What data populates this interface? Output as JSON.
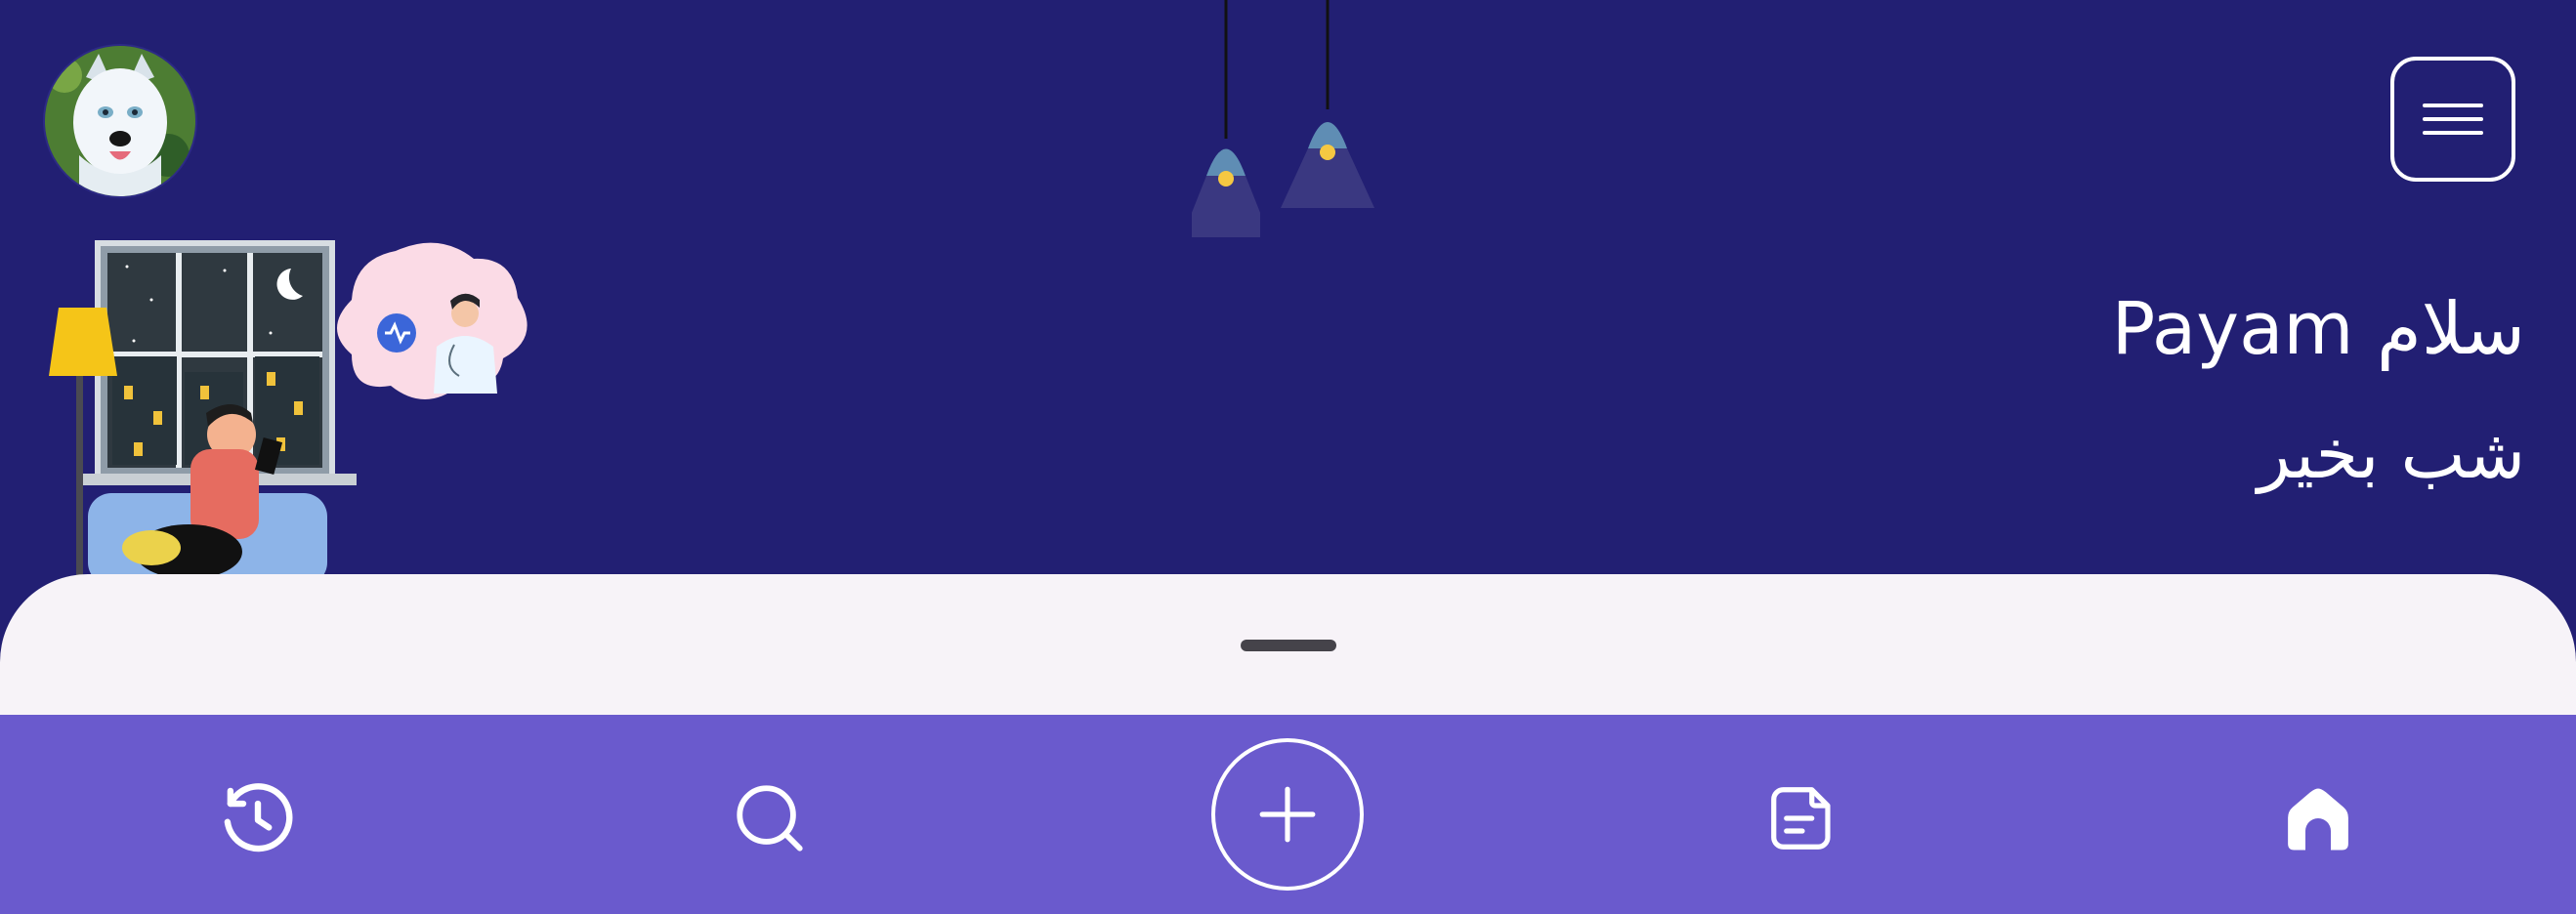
{
  "header": {
    "greeting": "سلام Payam",
    "sub_greeting": "شب بخیر"
  },
  "icons": {
    "menu": "hamburger-menu-icon",
    "avatar": "profile-avatar",
    "history": "history-icon",
    "search": "search-icon",
    "add": "plus-icon",
    "document": "document-icon",
    "home": "home-icon"
  },
  "colors": {
    "header_background": "#221f73",
    "bottom_nav_background": "#6a5acd",
    "sheet_background": "#f7f3f8",
    "text": "#ffffff"
  }
}
